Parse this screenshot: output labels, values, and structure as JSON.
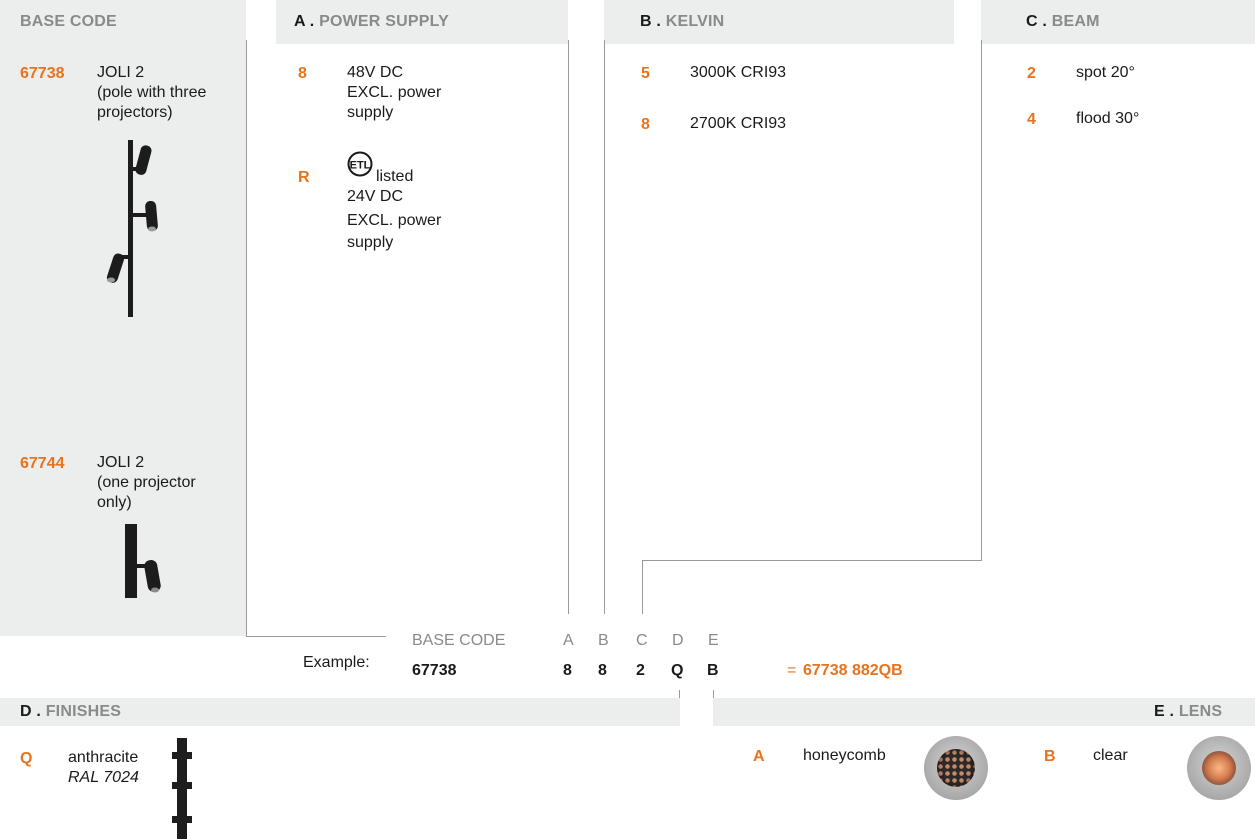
{
  "headers": {
    "base_code": "BASE CODE",
    "power": {
      "letter": "A .",
      "title": "POWER SUPPLY"
    },
    "kelvin": {
      "letter": "B .",
      "title": "KELVIN"
    },
    "beam": {
      "letter": "C .",
      "title": "BEAM"
    },
    "finishes": {
      "letter": "D .",
      "title": "FINISHES"
    },
    "lens": {
      "letter": "E .",
      "title": "LENS"
    }
  },
  "base_codes": [
    {
      "code": "67738",
      "lines": [
        "JOLI 2",
        "(pole with three",
        "projectors)"
      ]
    },
    {
      "code": "67744",
      "lines": [
        "JOLI 2",
        "(one projector",
        "only)"
      ]
    }
  ],
  "power_supply": [
    {
      "code": "8",
      "lines": [
        "48V DC",
        "EXCL. power",
        "supply"
      ]
    },
    {
      "code": "R",
      "badge": "ETL",
      "listed": "listed",
      "lines": [
        "24V DC",
        "EXCL. power",
        "supply"
      ]
    }
  ],
  "kelvin": [
    {
      "code": "5",
      "label": "3000K CRI93"
    },
    {
      "code": "8",
      "label": "2700K CRI93"
    }
  ],
  "beam": [
    {
      "code": "2",
      "label": "spot 20°"
    },
    {
      "code": "4",
      "label": "flood 30°"
    }
  ],
  "example": {
    "label": "Example:",
    "base_code_header": "BASE CODE",
    "letters": [
      "A",
      "B",
      "C",
      "D",
      "E"
    ],
    "base_value": "67738",
    "values": [
      "8",
      "8",
      "2",
      "Q",
      "B"
    ],
    "eq": "=",
    "result": "67738 882QB"
  },
  "finishes": [
    {
      "code": "Q",
      "label": "anthracite",
      "ral": "RAL 7024"
    }
  ],
  "lens": [
    {
      "code": "A",
      "label": "honeycomb"
    },
    {
      "code": "B",
      "label": "clear"
    }
  ],
  "colors": {
    "accent": "#e8731c",
    "panel": "#eceded",
    "finish": "#2b2b2b"
  }
}
